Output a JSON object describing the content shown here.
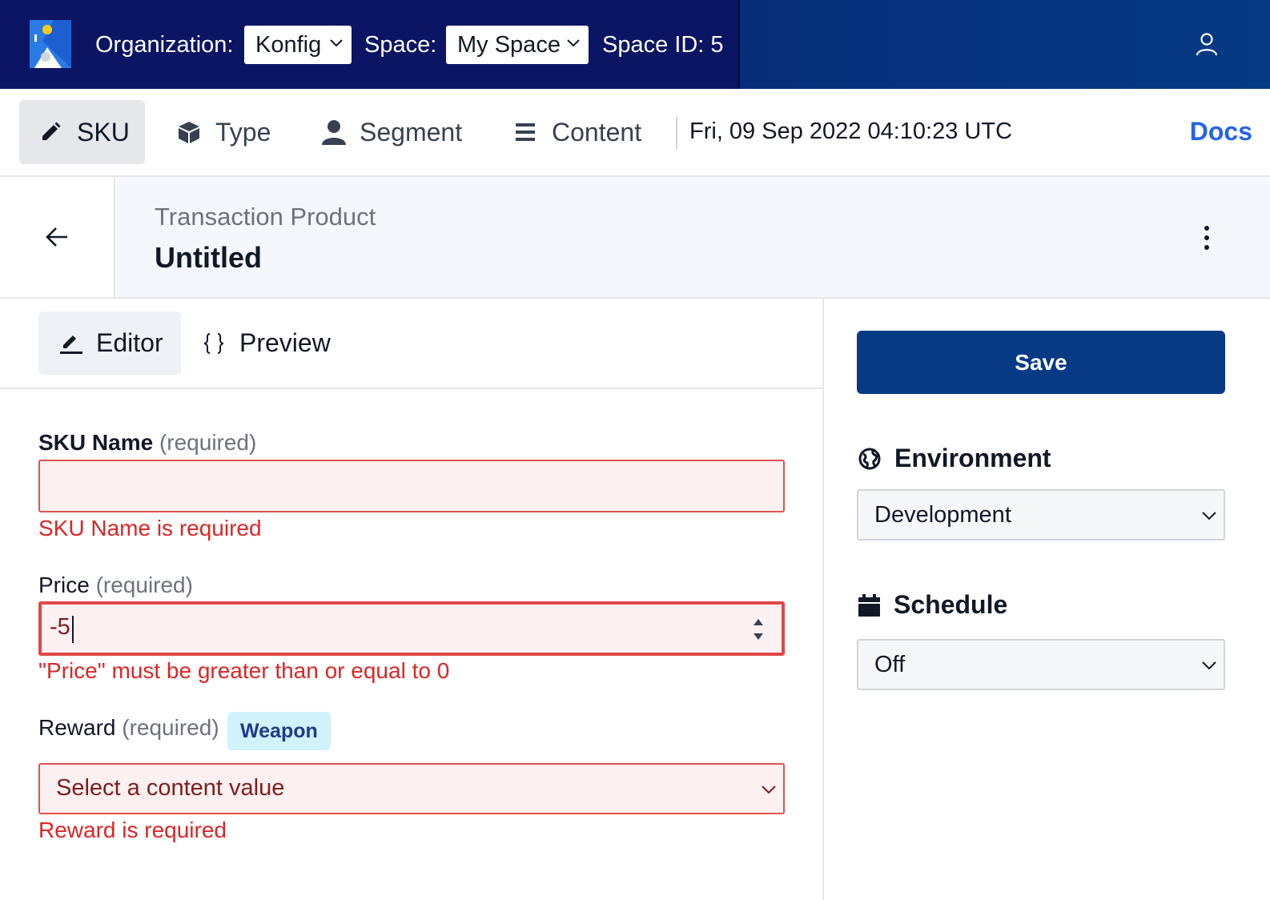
{
  "topbar": {
    "organization_label": "Organization:",
    "organization_value": "Konfig",
    "space_label": "Space:",
    "space_value": "My Space",
    "space_id": "Space ID: 5",
    "colors": {
      "primary": "#0b1563",
      "accent": "#063a85"
    }
  },
  "nav": {
    "items": [
      {
        "label": "SKU",
        "icon": "pencil-icon",
        "active": true
      },
      {
        "label": "Type",
        "icon": "cube-icon"
      },
      {
        "label": "Segment",
        "icon": "user-icon"
      },
      {
        "label": "Content",
        "icon": "list-icon"
      }
    ],
    "datetime": "Fri, 09 Sep 2022 04:10:23 UTC",
    "docs": "Docs"
  },
  "header": {
    "subtitle": "Transaction Product",
    "title": "Untitled"
  },
  "editor": {
    "tabs": [
      {
        "label": "Editor",
        "icon": "edit-icon",
        "active": true
      },
      {
        "label": "Preview",
        "icon": "braces-icon"
      }
    ],
    "required_text": "(required)",
    "sku_name": {
      "label": "SKU Name",
      "value": "",
      "error": "SKU Name is required"
    },
    "price": {
      "label": "Price",
      "value": "-5",
      "error": "\"Price\" must be greater than or equal to 0"
    },
    "reward": {
      "label": "Reward",
      "badge": "Weapon",
      "value": "Select a content value",
      "error": "Reward is required"
    }
  },
  "sidebar": {
    "save": "Save",
    "environment": {
      "heading": "Environment",
      "icon": "globe-icon",
      "value": "Development"
    },
    "schedule": {
      "heading": "Schedule",
      "icon": "calendar-icon",
      "value": "Off"
    }
  }
}
